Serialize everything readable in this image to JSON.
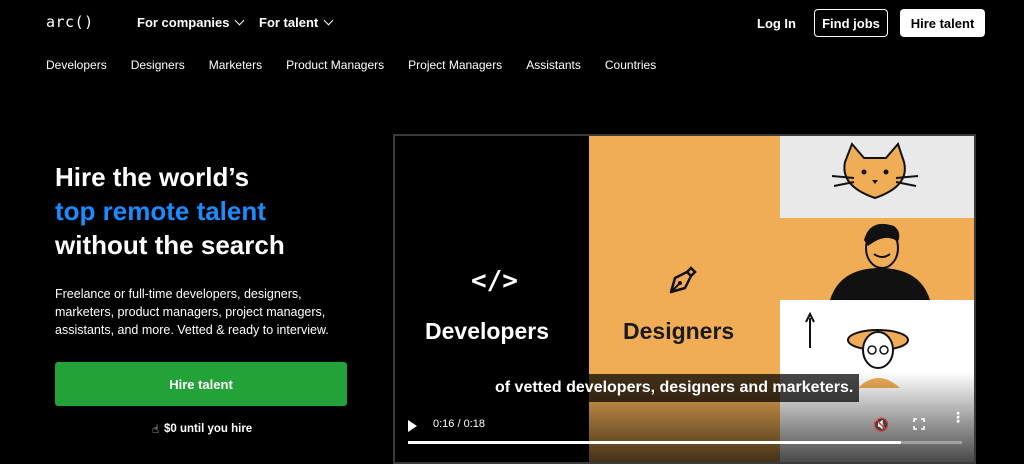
{
  "header": {
    "logo": "arc()",
    "menus": [
      {
        "label": "For companies"
      },
      {
        "label": "For talent"
      }
    ],
    "login": "Log In",
    "find_jobs": "Find jobs",
    "hire_talent": "Hire talent"
  },
  "categories": [
    "Developers",
    "Designers",
    "Marketers",
    "Product Managers",
    "Project Managers",
    "Assistants",
    "Countries"
  ],
  "hero": {
    "line1": "Hire the world’s",
    "line2": "top remote talent",
    "line3": "without the search",
    "description": "Freelance or full-time developers, designers, marketers, product managers, project managers, assistants, and more. Vetted & ready to interview.",
    "cta": "Hire talent",
    "cta_note": "$0 until you hire",
    "accent_color": "#1a8cff",
    "cta_color": "#23a23a"
  },
  "video": {
    "developers_label": "Developers",
    "designers_label": "Designers",
    "caption": "of vetted developers, designers and marketers.",
    "time": "0:16 / 0:18",
    "progress": 0.89,
    "panel_color": "#f0ad55",
    "icons": [
      "code-icon",
      "pen-nib-icon",
      "play-icon",
      "mute-icon",
      "fullscreen-icon",
      "more-vert-icon"
    ]
  }
}
